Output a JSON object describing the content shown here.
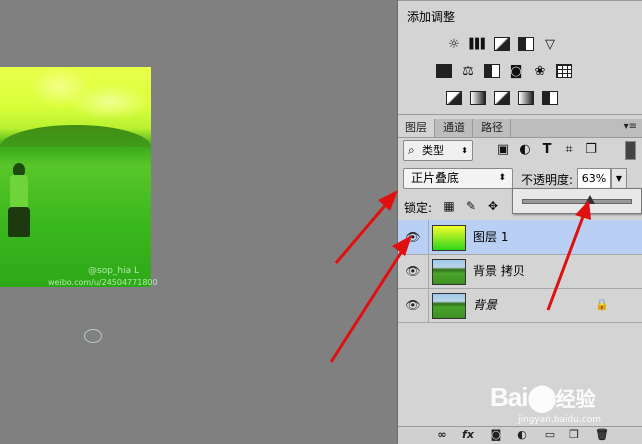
{
  "canvas": {
    "watermark_handle": "@sop_hia L",
    "watermark_url": "weibo.com/u/24504771800"
  },
  "adjustments": {
    "title": "添加调整",
    "row1_icons": [
      "brightness-icon",
      "levels-icon",
      "curves-icon",
      "exposure-icon",
      "vibrance-icon"
    ],
    "row2_icons": [
      "hue-saturation-icon",
      "color-balance-icon",
      "black-white-icon",
      "photo-filter-icon",
      "channel-mixer-icon",
      "color-lookup-icon"
    ],
    "row3_icons": [
      "invert-icon",
      "posterize-icon",
      "threshold-icon",
      "gradient-map-icon",
      "selective-color-icon"
    ]
  },
  "layers_panel": {
    "tabs": [
      {
        "label": "图层",
        "active": true
      },
      {
        "label": "通道",
        "active": false
      },
      {
        "label": "路径",
        "active": false
      }
    ],
    "filter_type": "类型",
    "blend_mode": "正片叠底",
    "opacity_label": "不透明度:",
    "opacity_value": "63%",
    "opacity_fraction": 0.63,
    "lock_label": "锁定:",
    "layers": [
      {
        "name": "图层 1",
        "thumb": "gradient",
        "selected": true,
        "visible": true,
        "italic": false,
        "locked": false
      },
      {
        "name": "背景 拷贝",
        "thumb": "photo",
        "selected": false,
        "visible": true,
        "italic": false,
        "locked": false
      },
      {
        "name": "背景",
        "thumb": "photo",
        "selected": false,
        "visible": true,
        "italic": true,
        "locked": true
      }
    ],
    "bottom_icons": [
      "link-icon",
      "fx-icon",
      "mask-icon",
      "adjustment-icon",
      "group-icon",
      "new-layer-icon",
      "trash-icon"
    ],
    "bottom_labels": {
      "fx": "fx"
    }
  },
  "watermark": {
    "brand_left": "Bai",
    "brand_right": "经验",
    "url": "jingyan.baidu.com"
  },
  "colors": {
    "selected_layer": "#b9cff3",
    "annotation_arrows": "#e01010"
  }
}
